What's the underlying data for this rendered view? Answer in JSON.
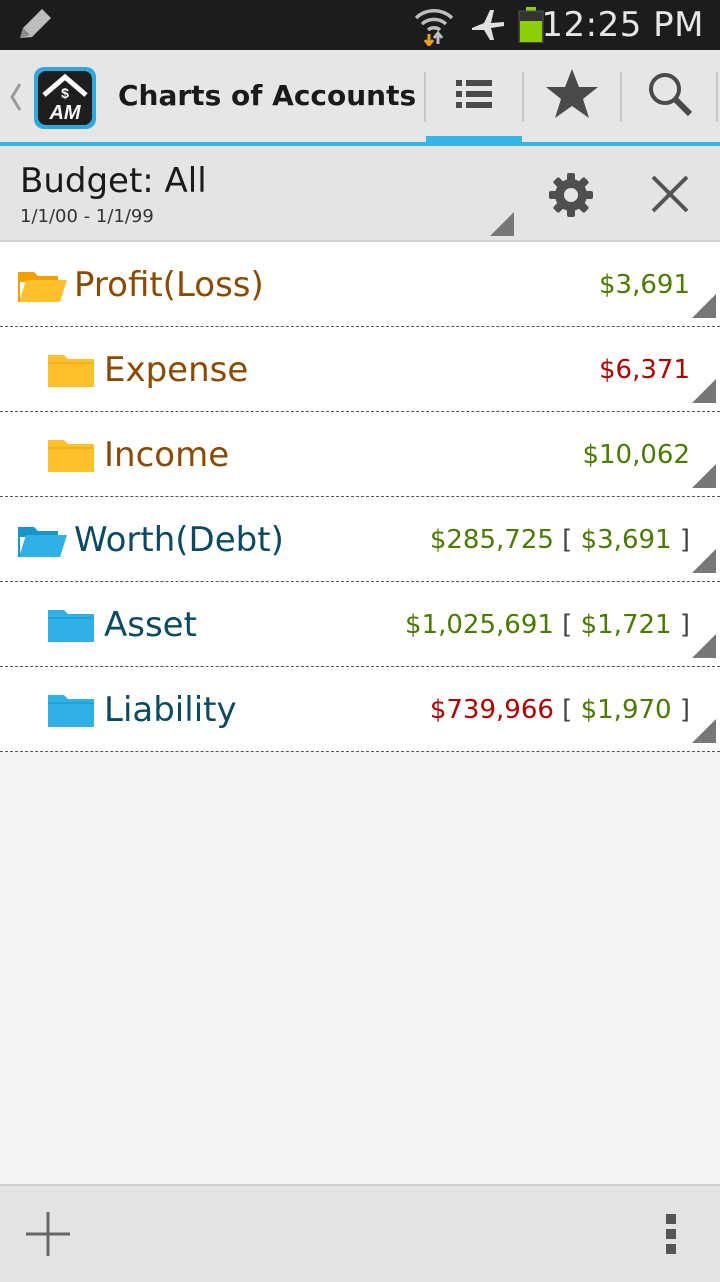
{
  "status_bar": {
    "time": "12:25 PM",
    "icons": [
      "pencil-icon",
      "wifi-icon",
      "airplane-icon",
      "battery-icon"
    ]
  },
  "action_bar": {
    "title": "Charts of Accounts",
    "logo_text": "$ AM",
    "tabs": [
      {
        "icon": "list-icon",
        "active": true
      },
      {
        "icon": "star-icon",
        "active": false
      },
      {
        "icon": "search-icon",
        "active": false
      }
    ]
  },
  "budget": {
    "label": "Budget: All",
    "range": "1/1/00 - 1/1/99"
  },
  "accounts": [
    {
      "name": "Profit(Loss)",
      "value": "$3,691",
      "value_color": "positive",
      "bracket": "",
      "type": "open-orange",
      "indent": 0
    },
    {
      "name": "Expense",
      "value": "$6,371",
      "value_color": "negative",
      "bracket": "",
      "type": "closed-orange",
      "indent": 1
    },
    {
      "name": "Income",
      "value": "$10,062",
      "value_color": "positive",
      "bracket": "",
      "type": "closed-orange",
      "indent": 1
    },
    {
      "name": "Worth(Debt)",
      "value": "$285,725",
      "value_color": "positive",
      "bracket": "$3,691",
      "type": "open-blue",
      "indent": 0
    },
    {
      "name": "Asset",
      "value": "$1,025,691",
      "value_color": "positive",
      "bracket": "$1,721",
      "type": "closed-blue",
      "indent": 1
    },
    {
      "name": "Liability",
      "value": "$739,966",
      "value_color": "negative",
      "bracket": "$1,970",
      "type": "closed-blue",
      "indent": 1
    }
  ],
  "colors": {
    "accent": "#33b5e5",
    "positive": "#4a7a00",
    "negative": "#b00000",
    "orange_text": "#8a4a00",
    "blue_text": "#0b4a60",
    "folder_orange": "#ffc02e",
    "folder_blue": "#2fb0e6"
  }
}
